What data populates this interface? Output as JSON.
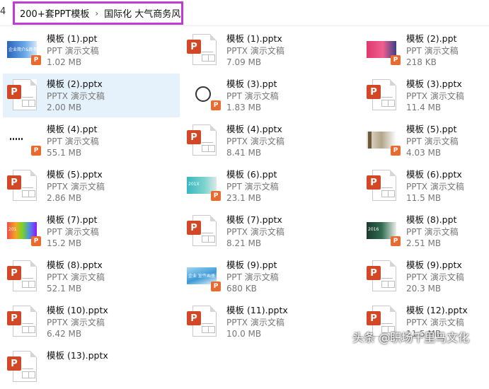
{
  "breadcrumb": {
    "edge_chevron": "4",
    "items": [
      "200+套PPT模板",
      "国际化 大气商务风"
    ],
    "separator": "›"
  },
  "files": [
    {
      "name": "模板 (1).ppt",
      "type": "PPT 演示文稿",
      "size": "1.02 MB",
      "thumb": "preview-blue",
      "thumb_text": "企业简介&商务"
    },
    {
      "name": "模板 (1).pptx",
      "type": "PPTX 演示文稿",
      "size": "7.09 MB",
      "thumb": "pptx-icon"
    },
    {
      "name": "模板 (2).ppt",
      "type": "PPT 演示文稿",
      "size": "218 KB",
      "thumb": "preview-pink"
    },
    {
      "name": "模板 (2).pptx",
      "type": "PPTX 演示文稿",
      "size": "2.00 MB",
      "thumb": "pptx-icon",
      "selected": true
    },
    {
      "name": "模板 (3).ppt",
      "type": "PPT 演示文稿",
      "size": "1.83 MB",
      "thumb": "preview-ring"
    },
    {
      "name": "模板 (3).pptx",
      "type": "PPTX 演示文稿",
      "size": "11.4 MB",
      "thumb": "pptx-icon"
    },
    {
      "name": "模板 (4).ppt",
      "type": "PPT 演示文稿",
      "size": "55.1 MB",
      "thumb": "preview-dots"
    },
    {
      "name": "模板 (4).pptx",
      "type": "PPTX 演示文稿",
      "size": "8.41 MB",
      "thumb": "pptx-icon"
    },
    {
      "name": "模板 (5).ppt",
      "type": "PPT 演示文稿",
      "size": "4.03 MB",
      "thumb": "preview-gray"
    },
    {
      "name": "模板 (5).pptx",
      "type": "PPTX 演示文稿",
      "size": "2.86 MB",
      "thumb": "pptx-icon"
    },
    {
      "name": "模板 (6).ppt",
      "type": "PPT 演示文稿",
      "size": "23.1 MB",
      "thumb": "preview-teal",
      "thumb_text": "201X"
    },
    {
      "name": "模板 (6).pptx",
      "type": "PPTX 演示文稿",
      "size": "11.5 MB",
      "thumb": "pptx-icon"
    },
    {
      "name": "模板 (7).ppt",
      "type": "PPT 演示文稿",
      "size": "15.2 MB",
      "thumb": "preview-color",
      "thumb_text": "201"
    },
    {
      "name": "模板 (7).pptx",
      "type": "PPTX 演示文稿",
      "size": "8.21 MB",
      "thumb": "pptx-icon"
    },
    {
      "name": "模板 (8).ppt",
      "type": "PPT 演示文稿",
      "size": "2.51 MB",
      "thumb": "preview-dark",
      "thumb_text": "2016"
    },
    {
      "name": "模板 (8).pptx",
      "type": "PPTX 演示文稿",
      "size": "52.1 MB",
      "thumb": "pptx-icon"
    },
    {
      "name": "模板 (9).ppt",
      "type": "PPT 演示文稿",
      "size": "680 KB",
      "thumb": "preview-sky",
      "thumb_text": "企业 宣传画册"
    },
    {
      "name": "模板 (9).pptx",
      "type": "PPTX 演示文稿",
      "size": "20.3 MB",
      "thumb": "pptx-icon"
    },
    {
      "name": "模板 (10).pptx",
      "type": "PPTX 演示文稿",
      "size": "6.42 MB",
      "thumb": "pptx-icon"
    },
    {
      "name": "模板 (11).pptx",
      "type": "PPTX 演示文稿",
      "size": "10.0 MB",
      "thumb": "pptx-icon"
    },
    {
      "name": "模板 (12).pptx",
      "type": "PPTX 演示文稿",
      "size": "11.5 MB",
      "thumb": "pptx-icon"
    },
    {
      "name": "模板 (13).pptx",
      "type": "",
      "size": "",
      "thumb": "pptx-icon"
    }
  ],
  "badge_letter": "P",
  "watermark": "头条 @职场千里马文化",
  "colors": {
    "selection": "#e5f1fb",
    "highlight_border": "#c23ad6",
    "ppt_orange": "#d24726"
  }
}
